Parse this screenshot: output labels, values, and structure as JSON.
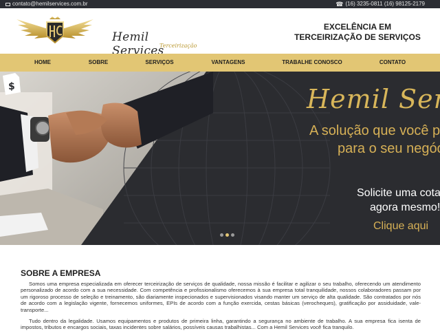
{
  "topbar": {
    "email": "contato@hemilservices.com.br",
    "phones": "(16) 3235-0811 (16) 98125-2179"
  },
  "header": {
    "logo_name": "Hemil Services",
    "logo_sub": "Terceirização",
    "tagline_line1": "EXCELÊNCIA EM",
    "tagline_line2": "TERCEIRIZAÇÃO DE SERVIÇOS"
  },
  "nav": {
    "items": [
      "HOME",
      "SOBRE",
      "SERVIÇOS",
      "VANTAGENS",
      "TRABALHE CONOSCO",
      "CONTATO"
    ]
  },
  "hero": {
    "script_title": "Hemil Services",
    "line1": "A solução que você procura",
    "line2": "para o seu negócio",
    "cta_line1": "Solicite uma cotação",
    "cta_line2": "agora mesmo!",
    "click": "Clique aqui"
  },
  "about": {
    "title": "SOBRE A EMPRESA",
    "p1": "Somos uma empresa especializada em oferecer terceirização de serviços de qualidade, nossa missão é facilitar e agilizar o seu trabalho, oferecendo um atendimento personalizado de acordo com a sua necessidade. Com competência e profissionalismo oferecemos à sua empresa total tranquilidade, nossos colaboradores passam por um rigoroso processo de seleção e treinamento, são diariamente inspecionados e supervisionados visando manter um serviço de alta qualidade. São contratados por nós de acordo com a legislação vigente, fornecemos uniformes, EPIs de acordo com a função exercida, cestas básicas (verocheques), gratificação por assiduidade, vale-transporte...",
    "p2": "Tudo dentro da legalidade. Usamos equipamentos e produtos de primeira linha, garantindo a segurança no ambiente de trabalho. A sua empresa fica isenta de impostos, tributos e encargos sociais, taxas incidentes sobre salários, possíveis causas trabalhistas... Com a Hemil Services você fica tranquilo."
  },
  "colors": {
    "gold": "#e2c674",
    "dark": "#2b2d33",
    "hero_gold": "#d6b056"
  }
}
